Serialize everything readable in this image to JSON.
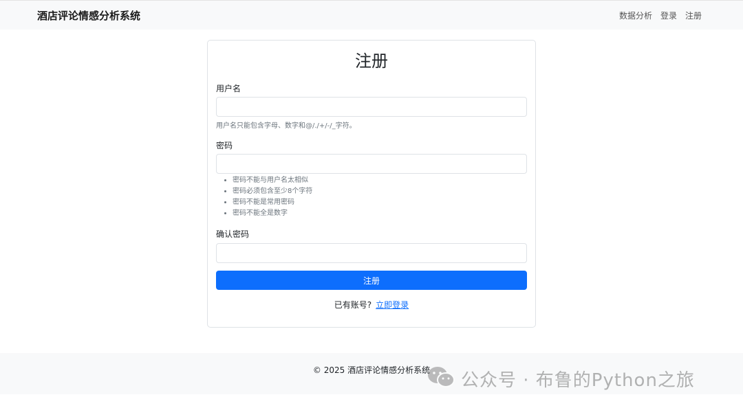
{
  "navbar": {
    "brand": "酒店评论情感分析系统",
    "links": [
      "数据分析",
      "登录",
      "注册"
    ]
  },
  "form": {
    "title": "注册",
    "username": {
      "label": "用户名",
      "value": "",
      "help": "用户名只能包含字母、数字和@/./+/-/_字符。"
    },
    "password": {
      "label": "密码",
      "value": "",
      "rules": [
        "密码不能与用户名太相似",
        "密码必须包含至少8个字符",
        "密码不能是常用密码",
        "密码不能全是数字"
      ]
    },
    "confirm": {
      "label": "确认密码",
      "value": ""
    },
    "submit_label": "注册",
    "login_prompt": "已有账号?",
    "login_link": "立即登录"
  },
  "footer": {
    "text": "© 2025 酒店评论情感分析系统"
  },
  "watermark": {
    "text": "公众号 · 布鲁的Python之旅",
    "icon": "wechat-icon"
  }
}
